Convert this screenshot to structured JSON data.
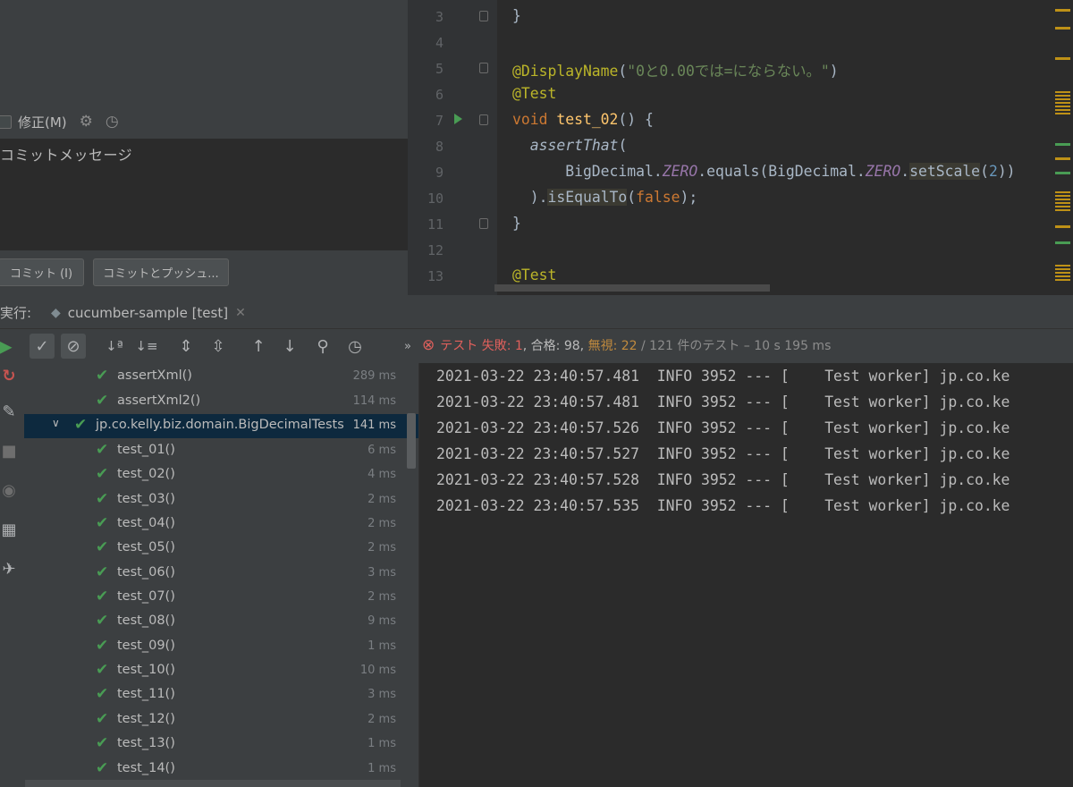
{
  "commit_panel": {
    "amend_label": "修正(M)",
    "message_placeholder": "コミットメッセージ",
    "commit_button": "コミット (I)",
    "commit_push_button": "コミットとプッシュ..."
  },
  "editor": {
    "line_numbers": [
      "3",
      "4",
      "5",
      "6",
      "7",
      "8",
      "9",
      "10",
      "11",
      "12",
      "13"
    ]
  },
  "run_panel": {
    "label": "実行:",
    "tab_title": "cucumber-sample [test]",
    "status": {
      "failed_label": "テスト 失敗: 1",
      "passed_label": ", 合格: 98, ",
      "ignored_label": "無視: 22",
      "summary": " / 121 件のテスト – 10 s 195 ms"
    },
    "tree": [
      {
        "name": "assertXml()",
        "time": "289 ms"
      },
      {
        "name": "assertXml2()",
        "time": "114 ms"
      },
      {
        "name": "jp.co.kelly.biz.domain.BigDecimalTests",
        "time": "141 ms"
      },
      {
        "name": "test_01()",
        "time": "6 ms"
      },
      {
        "name": "test_02()",
        "time": "4 ms"
      },
      {
        "name": "test_03()",
        "time": "2 ms"
      },
      {
        "name": "test_04()",
        "time": "2 ms"
      },
      {
        "name": "test_05()",
        "time": "2 ms"
      },
      {
        "name": "test_06()",
        "time": "3 ms"
      },
      {
        "name": "test_07()",
        "time": "2 ms"
      },
      {
        "name": "test_08()",
        "time": "9 ms"
      },
      {
        "name": "test_09()",
        "time": "1 ms"
      },
      {
        "name": "test_10()",
        "time": "10 ms"
      },
      {
        "name": "test_11()",
        "time": "3 ms"
      },
      {
        "name": "test_12()",
        "time": "2 ms"
      },
      {
        "name": "test_13()",
        "time": "1 ms"
      },
      {
        "name": "test_14()",
        "time": "1 ms"
      }
    ],
    "console": [
      "2021-03-22 23:40:57.481  INFO 3952 --- [    Test worker] jp.co.ke",
      "2021-03-22 23:40:57.481  INFO 3952 --- [    Test worker] jp.co.ke",
      "2021-03-22 23:40:57.526  INFO 3952 --- [    Test worker] jp.co.ke",
      "2021-03-22 23:40:57.527  INFO 3952 --- [    Test worker] jp.co.ke",
      "2021-03-22 23:40:57.528  INFO 3952 --- [    Test worker] jp.co.ke",
      "2021-03-22 23:40:57.535  INFO 3952 --- [    Test worker] jp.co.ke"
    ]
  },
  "colors": {
    "accent_pass": "#499c54",
    "failed": "#e0605c",
    "ignored": "#c08a3e",
    "selection": "#0d293e"
  }
}
